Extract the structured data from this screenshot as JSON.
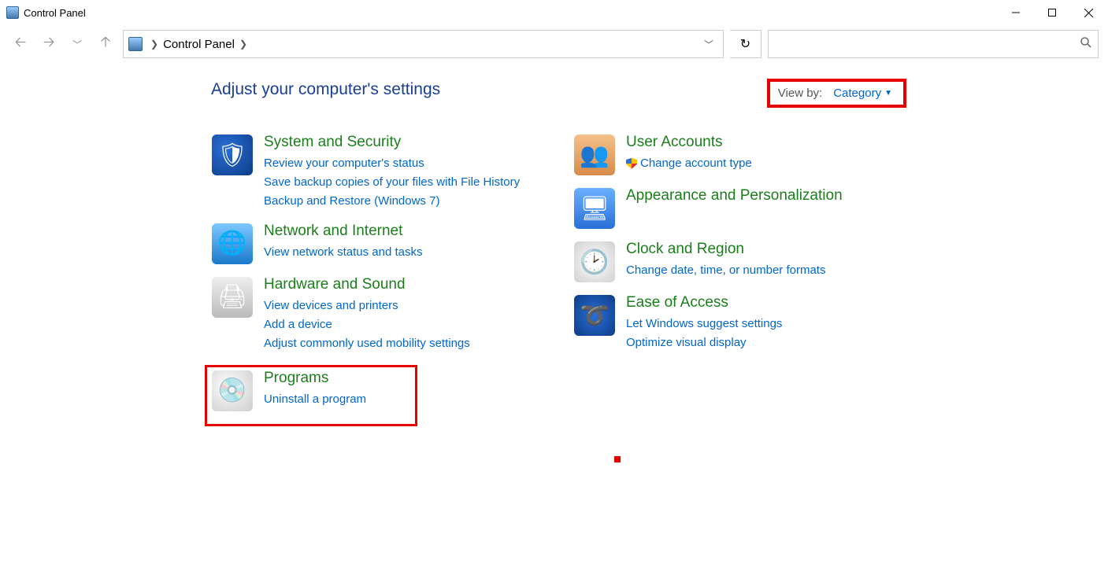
{
  "window": {
    "title": "Control Panel"
  },
  "address": {
    "location": "Control Panel"
  },
  "heading": "Adjust your computer's settings",
  "viewby": {
    "label": "View by:",
    "value": "Category"
  },
  "left": {
    "system": {
      "title": "System and Security",
      "links": [
        "Review your computer's status",
        "Save backup copies of your files with File History",
        "Backup and Restore (Windows 7)"
      ]
    },
    "network": {
      "title": "Network and Internet",
      "links": [
        "View network status and tasks"
      ]
    },
    "hardware": {
      "title": "Hardware and Sound",
      "links": [
        "View devices and printers",
        "Add a device",
        "Adjust commonly used mobility settings"
      ]
    },
    "programs": {
      "title": "Programs",
      "links": [
        "Uninstall a program"
      ]
    }
  },
  "right": {
    "users": {
      "title": "User Accounts",
      "links": [
        "Change account type"
      ]
    },
    "appearance": {
      "title": "Appearance and Personalization"
    },
    "clock": {
      "title": "Clock and Region",
      "links": [
        "Change date, time, or number formats"
      ]
    },
    "ease": {
      "title": "Ease of Access",
      "links": [
        "Let Windows suggest settings",
        "Optimize visual display"
      ]
    }
  }
}
